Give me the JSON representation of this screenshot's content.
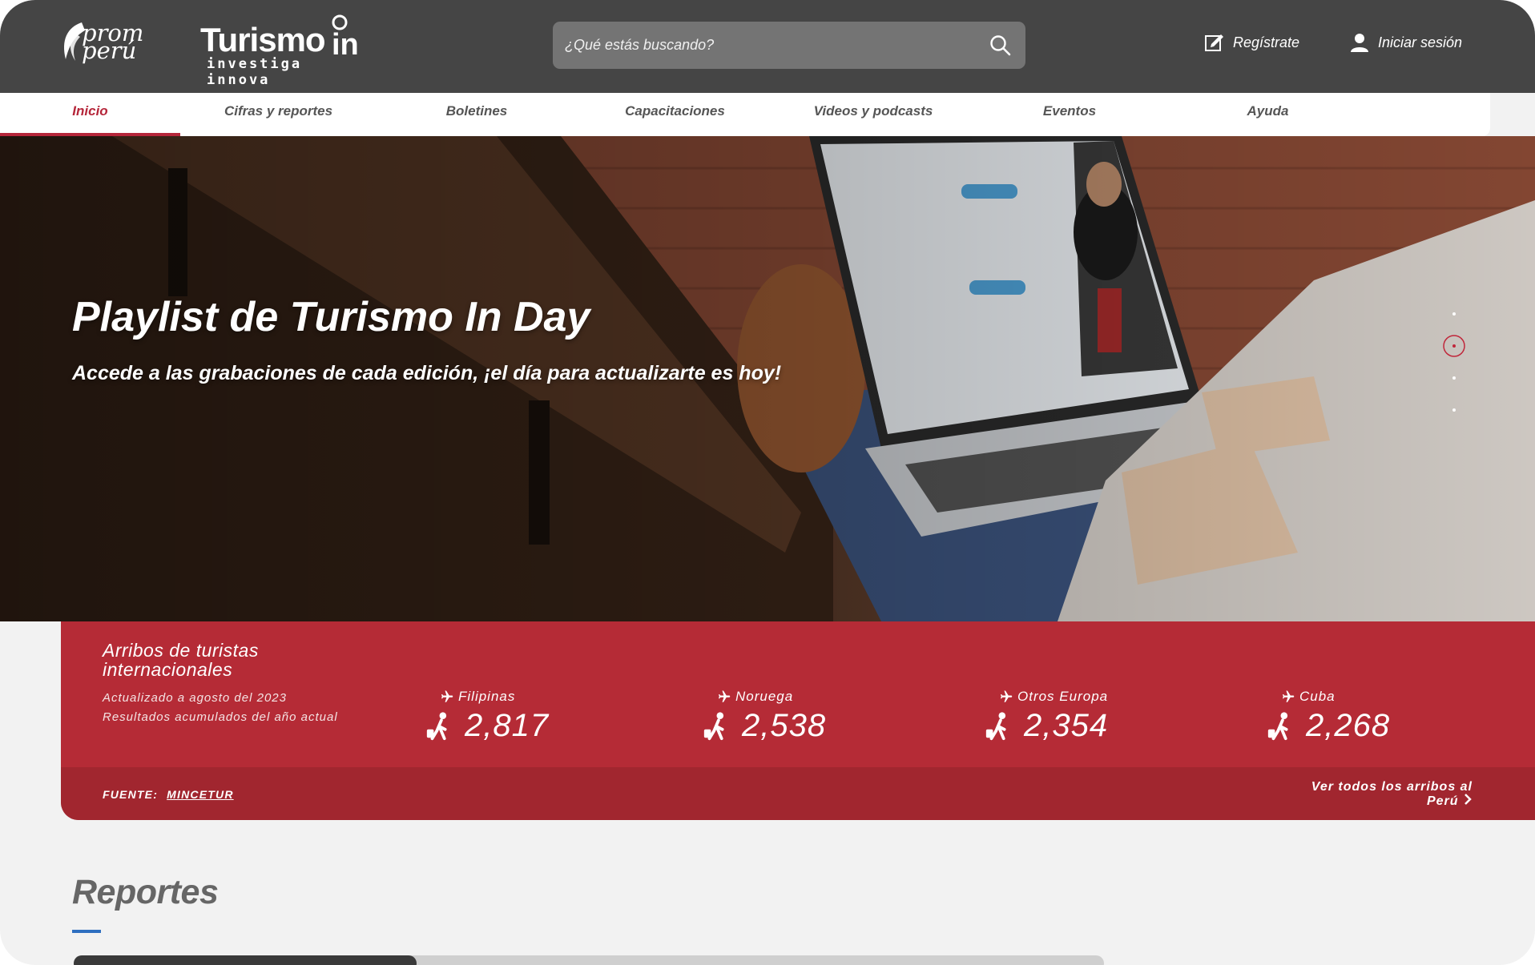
{
  "header": {
    "logo_promperu_text": "prom perú",
    "logo_turismo_main": "Turismo",
    "logo_turismo_in": "in",
    "logo_turismo_sub": "investiga innova",
    "search_placeholder": "¿Qué estás buscando?",
    "register_label": "Regístrate",
    "login_label": "Iniciar sesión"
  },
  "nav": {
    "items": [
      {
        "label": "Inicio",
        "active": true
      },
      {
        "label": "Cifras y reportes"
      },
      {
        "label": "Boletines"
      },
      {
        "label": "Capacitaciones"
      },
      {
        "label": "Videos y podcasts"
      },
      {
        "label": "Eventos"
      },
      {
        "label": "Ayuda"
      }
    ]
  },
  "hero": {
    "title": "Playlist de Turismo In Day",
    "subtitle": "Accede a las grabaciones de cada edición, ¡el día para actualizarte es hoy!",
    "slides_count": 4,
    "active_slide": 2
  },
  "arrivals": {
    "title": "Arribos de turistas internacionales",
    "updated": "Actualizado a agosto del 2023",
    "note": "Resultados acumulados del año actual",
    "stats": [
      {
        "country": "Filipinas",
        "value": "2,817"
      },
      {
        "country": "Noruega",
        "value": "2,538"
      },
      {
        "country": "Otros Europa",
        "value": "2,354"
      },
      {
        "country": "Cuba",
        "value": "2,268"
      }
    ],
    "source_label": "FUENTE:",
    "source_link": "MINCETUR",
    "see_all_label": "Ver todos los arribos al Perú"
  },
  "reports": {
    "title": "Reportes"
  },
  "colors": {
    "header_bg": "#454545",
    "accent_red": "#b52b36",
    "accent_red_dark": "#a1262f",
    "nav_active": "#b5263a",
    "link_blue": "#2e6fc0"
  }
}
